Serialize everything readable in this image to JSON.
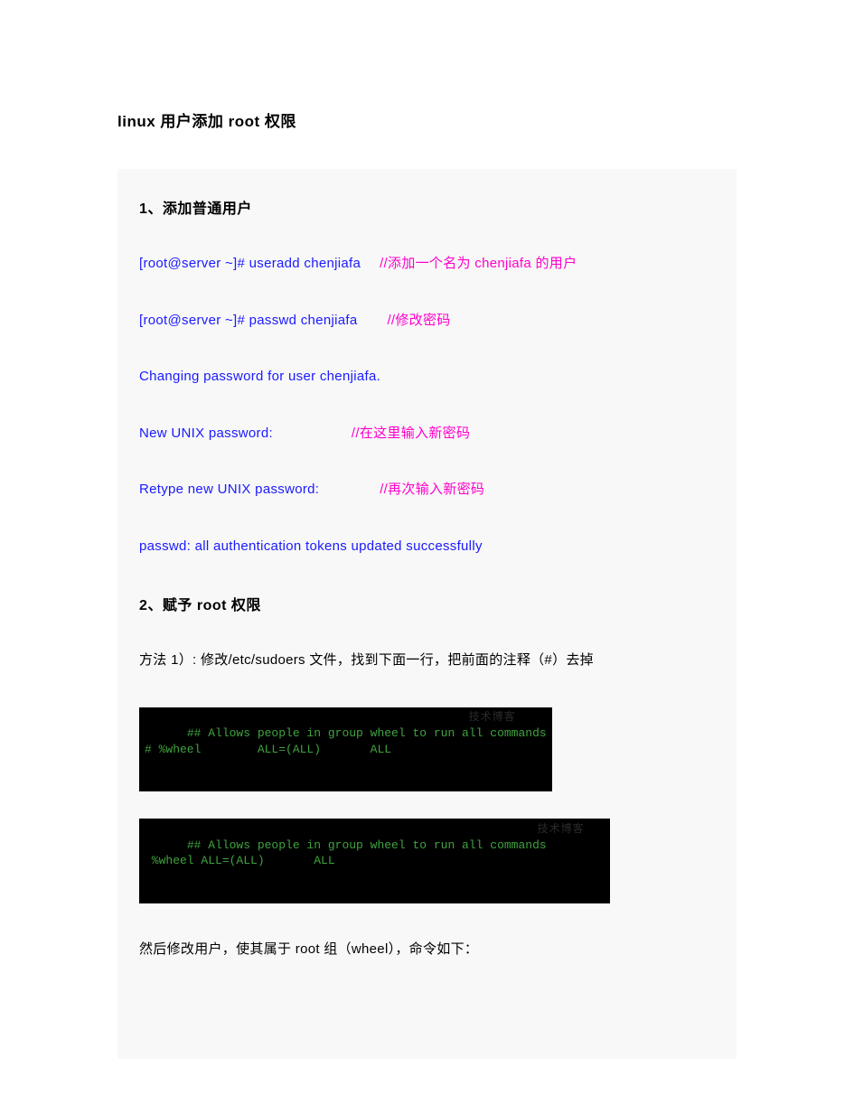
{
  "title": "linux 用户添加 root 权限",
  "section1": {
    "heading": "1、添加普通用户",
    "line1_cmd": "[root@server ~]# useradd chenjiafa",
    "line1_comment": "//添加一个名为 chenjiafa 的用户",
    "line2_cmd": "[root@server ~]# passwd chenjiafa",
    "line2_comment": "//修改密码",
    "line3": "Changing password for user chenjiafa.",
    "line4_cmd": "New UNIX password:",
    "line4_comment": "//在这里输入新密码",
    "line5_cmd": "Retype new UNIX password:",
    "line5_comment": "//再次输入新密码",
    "line6": "passwd: all authentication tokens updated successfully"
  },
  "section2": {
    "heading": "2、赋予 root 权限",
    "line1": "方法 1）: 修改/etc/sudoers 文件，找到下面一行，把前面的注释（#）去掉",
    "terminal1": "## Allows people in group wheel to run all commands\n# %wheel        ALL=(ALL)       ALL",
    "terminal2": "## Allows people in group wheel to run all commands\n %wheel ALL=(ALL)       ALL",
    "watermark": "技术博客",
    "line2": "然后修改用户，使其属于 root 组（wheel），命令如下："
  }
}
